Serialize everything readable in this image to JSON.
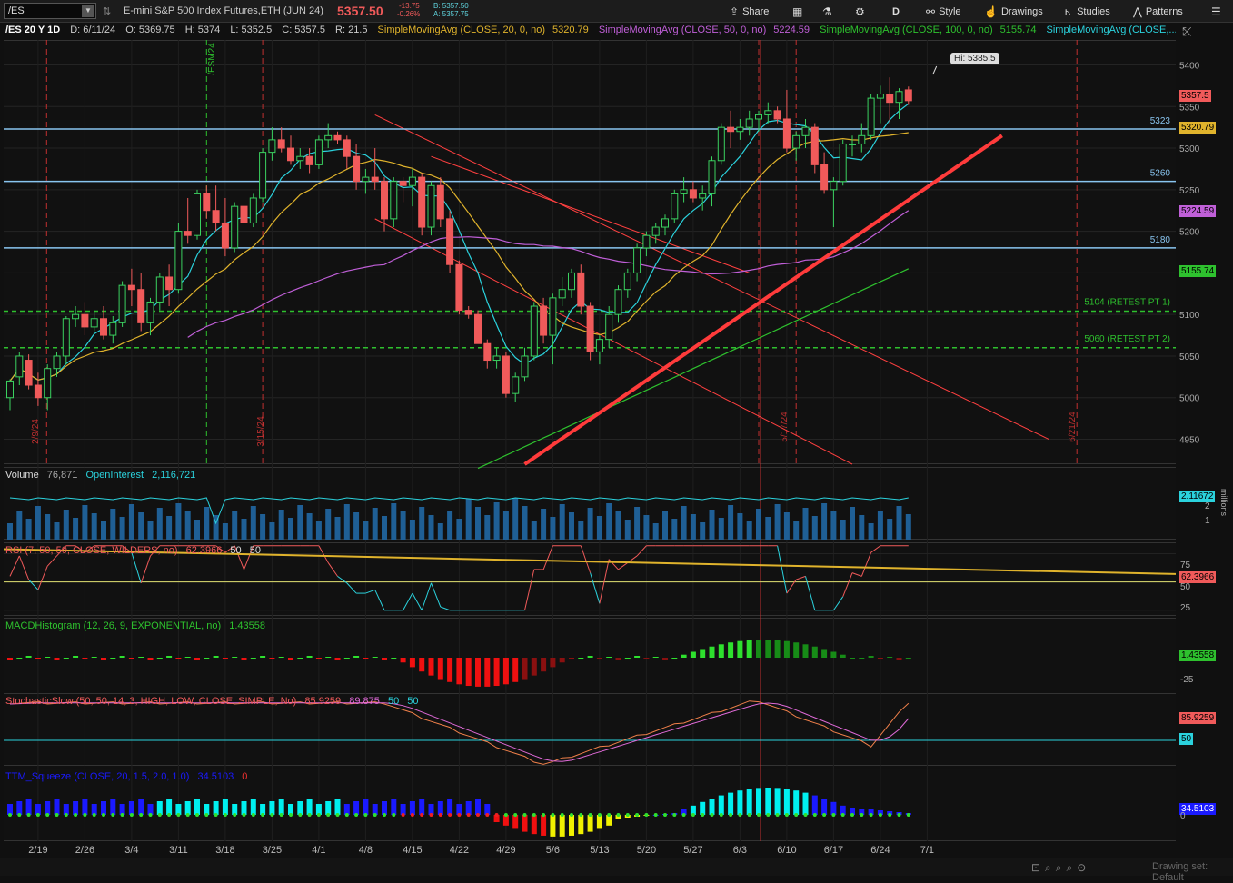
{
  "toolbar": {
    "symbol": "/ES",
    "description": "E-mini S&P 500 Index Futures,ETH (JUN 24)",
    "last": "5357.50",
    "change": "-13.75",
    "change_pct": "-0.26%",
    "bid": "B: 5357.50",
    "ask": "A: 5357.75",
    "share": "Share",
    "period": "D",
    "style": "Style",
    "drawings": "Drawings",
    "studies": "Studies",
    "patterns": "Patterns"
  },
  "info": {
    "title": "/ES 20 Y 1D",
    "date": "D: 6/11/24",
    "open": "O: 5369.75",
    "high": "H: 5374",
    "low": "L: 5352.5",
    "close": "C: 5357.5",
    "range": "R: 21.5",
    "sma20_label": "SimpleMovingAvg (CLOSE, 20, 0, no)",
    "sma20_val": "5320.79",
    "sma50_label": "SimpleMovingAvg (CLOSE, 50, 0, no)",
    "sma50_val": "5224.59",
    "sma100_label": "SimpleMovingAvg (CLOSE, 100, 0, no)",
    "sma100_val": "5155.74",
    "sma200_label": "SimpleMovingAvg (CLOSE,..."
  },
  "colors": {
    "up": "#3ad15f",
    "down": "#f05a5a",
    "sma20": "#2bd2dd",
    "sma50": "#e0b32c",
    "sma100": "#c05fd8",
    "sma200": "#2ec12e",
    "trend": "#ff3b3b",
    "level": "#89c5f0",
    "retest": "#2ec12e"
  },
  "chart_data": [
    {
      "type": "candlestick",
      "title": "/ES 20 Y 1D",
      "ylim": [
        4920,
        5430
      ],
      "y_ticks": [
        4950,
        5000,
        5050,
        5100,
        5150,
        5200,
        5250,
        5300,
        5350,
        5400
      ],
      "x_tick_labels": [
        "2/19",
        "2/26",
        "3/4",
        "3/11",
        "3/18",
        "3/25",
        "4/1",
        "4/8",
        "4/15",
        "4/22",
        "4/29",
        "5/6",
        "5/13",
        "5/20",
        "5/27",
        "6/3",
        "6/10",
        "6/17",
        "6/24",
        "7/1"
      ],
      "vertical_marker_labels": [
        "2/9/24",
        "3/15/24",
        "/ESM24",
        "5/17/24",
        "6/21/24"
      ],
      "hi_label": "Hi: 5385.5",
      "price_tags": {
        "last": "5357.5",
        "sma20": "5320.79",
        "sma50": "5224.59",
        "sma100": "5155.74"
      },
      "levels": [
        {
          "value": 5323,
          "label": "5323"
        },
        {
          "value": 5260,
          "label": "5260"
        },
        {
          "value": 5180,
          "label": "5180"
        }
      ],
      "retests": [
        {
          "value": 5104,
          "label": "5104 (RETEST PT 1)"
        },
        {
          "value": 5060,
          "label": "5060 (RETEST PT 2)"
        }
      ],
      "candles": [
        [
          5000,
          5022,
          4985,
          5020
        ],
        [
          5025,
          5055,
          5015,
          5050
        ],
        [
          5045,
          5052,
          5010,
          5015
        ],
        [
          5015,
          5030,
          4990,
          5000
        ],
        [
          5000,
          5040,
          4985,
          5035
        ],
        [
          5035,
          5055,
          5025,
          5050
        ],
        [
          5050,
          5098,
          5040,
          5095
        ],
        [
          5095,
          5110,
          5085,
          5100
        ],
        [
          5100,
          5115,
          5075,
          5085
        ],
        [
          5085,
          5105,
          5080,
          5095
        ],
        [
          5095,
          5110,
          5070,
          5075
        ],
        [
          5075,
          5098,
          5065,
          5090
        ],
        [
          5090,
          5140,
          5085,
          5135
        ],
        [
          5135,
          5155,
          5110,
          5130
        ],
        [
          5130,
          5150,
          5080,
          5090
        ],
        [
          5090,
          5120,
          5075,
          5115
        ],
        [
          5115,
          5150,
          5105,
          5145
        ],
        [
          5145,
          5160,
          5110,
          5130
        ],
        [
          5130,
          5210,
          5125,
          5200
        ],
        [
          5200,
          5240,
          5185,
          5195
        ],
        [
          5195,
          5250,
          5190,
          5245
        ],
        [
          5245,
          5255,
          5215,
          5225
        ],
        [
          5225,
          5255,
          5200,
          5210
        ],
        [
          5210,
          5240,
          5170,
          5180
        ],
        [
          5180,
          5235,
          5175,
          5230
        ],
        [
          5230,
          5240,
          5205,
          5210
        ],
        [
          5210,
          5245,
          5205,
          5240
        ],
        [
          5240,
          5300,
          5235,
          5295
        ],
        [
          5295,
          5325,
          5285,
          5310
        ],
        [
          5310,
          5325,
          5295,
          5300
        ],
        [
          5300,
          5315,
          5280,
          5285
        ],
        [
          5285,
          5300,
          5275,
          5290
        ],
        [
          5290,
          5300,
          5270,
          5280
        ],
        [
          5280,
          5315,
          5275,
          5310
        ],
        [
          5310,
          5330,
          5300,
          5315
        ],
        [
          5315,
          5320,
          5305,
          5310
        ],
        [
          5310,
          5315,
          5275,
          5290
        ],
        [
          5290,
          5305,
          5250,
          5260
        ],
        [
          5260,
          5275,
          5245,
          5265
        ],
        [
          5265,
          5300,
          5250,
          5260
        ],
        [
          5260,
          5265,
          5200,
          5215
        ],
        [
          5215,
          5265,
          5205,
          5260
        ],
        [
          5260,
          5265,
          5235,
          5255
        ],
        [
          5255,
          5275,
          5230,
          5265
        ],
        [
          5265,
          5270,
          5195,
          5205
        ],
        [
          5205,
          5260,
          5195,
          5255
        ],
        [
          5255,
          5265,
          5205,
          5215
        ],
        [
          5215,
          5225,
          5150,
          5160
        ],
        [
          5160,
          5165,
          5100,
          5105
        ],
        [
          5105,
          5110,
          5095,
          5100
        ],
        [
          5100,
          5105,
          5070,
          5065
        ],
        [
          5065,
          5070,
          5035,
          5045
        ],
        [
          5045,
          5060,
          5035,
          5050
        ],
        [
          5050,
          5055,
          5000,
          5005
        ],
        [
          5005,
          5030,
          4995,
          5025
        ],
        [
          5025,
          5060,
          5020,
          5050
        ],
        [
          5050,
          5115,
          5045,
          5110
        ],
        [
          5110,
          5120,
          5065,
          5075
        ],
        [
          5075,
          5125,
          5040,
          5120
        ],
        [
          5120,
          5145,
          5110,
          5130
        ],
        [
          5130,
          5155,
          5120,
          5150
        ],
        [
          5150,
          5160,
          5100,
          5110
        ],
        [
          5110,
          5115,
          5045,
          5055
        ],
        [
          5055,
          5075,
          5040,
          5070
        ],
        [
          5070,
          5110,
          5060,
          5100
        ],
        [
          5100,
          5135,
          5090,
          5130
        ],
        [
          5130,
          5155,
          5120,
          5150
        ],
        [
          5150,
          5185,
          5140,
          5180
        ],
        [
          5180,
          5200,
          5170,
          5195
        ],
        [
          5195,
          5210,
          5185,
          5205
        ],
        [
          5205,
          5220,
          5195,
          5215
        ],
        [
          5215,
          5250,
          5210,
          5245
        ],
        [
          5245,
          5265,
          5235,
          5250
        ],
        [
          5250,
          5260,
          5235,
          5240
        ],
        [
          5240,
          5255,
          5225,
          5245
        ],
        [
          5245,
          5290,
          5230,
          5285
        ],
        [
          5285,
          5330,
          5280,
          5325
        ],
        [
          5325,
          5345,
          5300,
          5320
        ],
        [
          5320,
          5335,
          5310,
          5325
        ],
        [
          5325,
          5345,
          5315,
          5335
        ],
        [
          5335,
          5345,
          5320,
          5340
        ],
        [
          5340,
          5355,
          5330,
          5345
        ],
        [
          5345,
          5350,
          5330,
          5335
        ],
        [
          5335,
          5370,
          5295,
          5300
        ],
        [
          5300,
          5320,
          5285,
          5315
        ],
        [
          5315,
          5335,
          5300,
          5325
        ],
        [
          5325,
          5330,
          5270,
          5280
        ],
        [
          5280,
          5295,
          5245,
          5250
        ],
        [
          5250,
          5265,
          5205,
          5260
        ],
        [
          5260,
          5310,
          5255,
          5305
        ],
        [
          5305,
          5315,
          5290,
          5305
        ],
        [
          5305,
          5330,
          5295,
          5315
        ],
        [
          5315,
          5365,
          5310,
          5360
        ],
        [
          5360,
          5375,
          5330,
          5365
        ],
        [
          5365,
          5385,
          5330,
          5355
        ],
        [
          5355,
          5372,
          5335,
          5368
        ],
        [
          5370,
          5374,
          5352,
          5357
        ]
      ]
    },
    {
      "type": "bar",
      "title": "Volume",
      "values_label": {
        "volume": "76,871",
        "open_interest_label": "OpenInterest",
        "open_interest": "2,116,721"
      },
      "axis_tag": "2.11672",
      "unit_label": "millions",
      "y_ticks": [
        "2",
        "1"
      ]
    },
    {
      "type": "line",
      "title": "RSI (7, 50, 50, CLOSE, WILDERS, no)",
      "value": "62.3966",
      "ob": "50",
      "os": "50",
      "y_ticks": [
        "75",
        "50",
        "25"
      ],
      "ylim": [
        20,
        85
      ]
    },
    {
      "type": "bar",
      "title": "MACDHistogram (12, 26, 9, EXPONENTIAL, no)",
      "value": "1.43558",
      "y_ticks": [
        "-25"
      ]
    },
    {
      "type": "line",
      "title": "StochasticSlow (50, 50, 14, 3, HIGH, LOW, CLOSE, SIMPLE, No)",
      "k": "85.9259",
      "d": "89.875",
      "ob": "50",
      "os": "50",
      "tag": "85.9259",
      "tag50": "50"
    },
    {
      "type": "bar",
      "title": "TTM_Squeeze (CLOSE, 20, 1.5, 2.0, 1.0)",
      "value": "34.5103",
      "value2": "0",
      "y_ticks": [
        "0"
      ]
    }
  ],
  "footer": {
    "status": "Drawing set: Default"
  }
}
